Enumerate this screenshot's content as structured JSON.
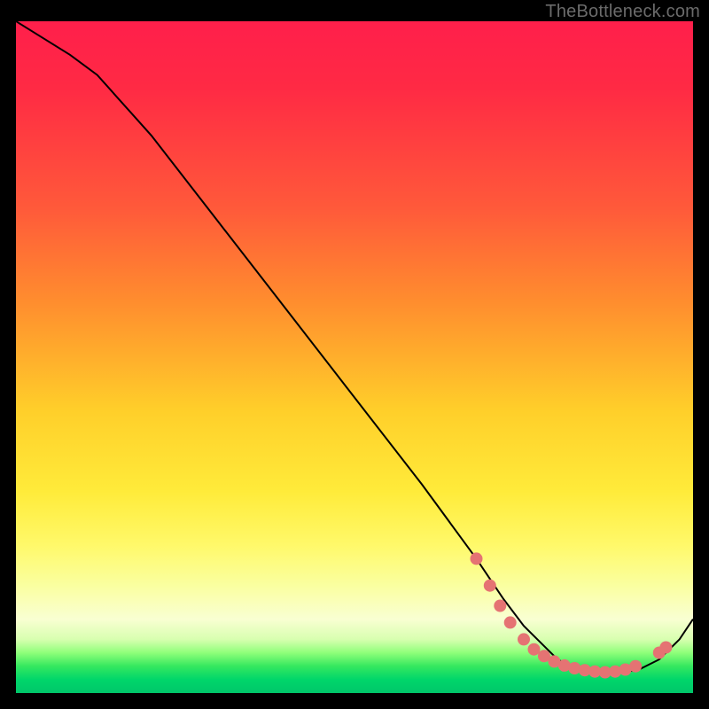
{
  "attribution": "TheBottleneck.com",
  "colors": {
    "background": "#000000",
    "gradient_stops": [
      "#ff1f4b",
      "#ff5a3a",
      "#ffcf2a",
      "#fff96a",
      "#f9ffd2",
      "#35e85f",
      "#00c66a"
    ],
    "curve": "#000000",
    "dot": "#e57373"
  },
  "chart_data": {
    "type": "line",
    "title": "",
    "xlabel": "",
    "ylabel": "",
    "xlim": [
      0,
      100
    ],
    "ylim": [
      0,
      100
    ],
    "grid": false,
    "legend": false,
    "x": [
      0,
      8,
      12,
      20,
      30,
      40,
      50,
      60,
      68,
      72,
      75,
      78,
      80,
      83,
      86,
      89,
      92,
      95,
      98,
      100
    ],
    "y": [
      100,
      95,
      92,
      83,
      70,
      57,
      44,
      31,
      20,
      14,
      10,
      7,
      5,
      3.5,
      3,
      3,
      3.5,
      5,
      8,
      11
    ],
    "points": [
      {
        "x": 68,
        "y": 20
      },
      {
        "x": 70,
        "y": 16
      },
      {
        "x": 71.5,
        "y": 13
      },
      {
        "x": 73,
        "y": 10.5
      },
      {
        "x": 75,
        "y": 8
      },
      {
        "x": 76.5,
        "y": 6.5
      },
      {
        "x": 78,
        "y": 5.5
      },
      {
        "x": 79.5,
        "y": 4.7
      },
      {
        "x": 81,
        "y": 4.1
      },
      {
        "x": 82.5,
        "y": 3.7
      },
      {
        "x": 84,
        "y": 3.4
      },
      {
        "x": 85.5,
        "y": 3.2
      },
      {
        "x": 87,
        "y": 3.1
      },
      {
        "x": 88.5,
        "y": 3.2
      },
      {
        "x": 90,
        "y": 3.5
      },
      {
        "x": 91.5,
        "y": 4
      },
      {
        "x": 95,
        "y": 6
      },
      {
        "x": 96,
        "y": 6.8
      }
    ]
  }
}
